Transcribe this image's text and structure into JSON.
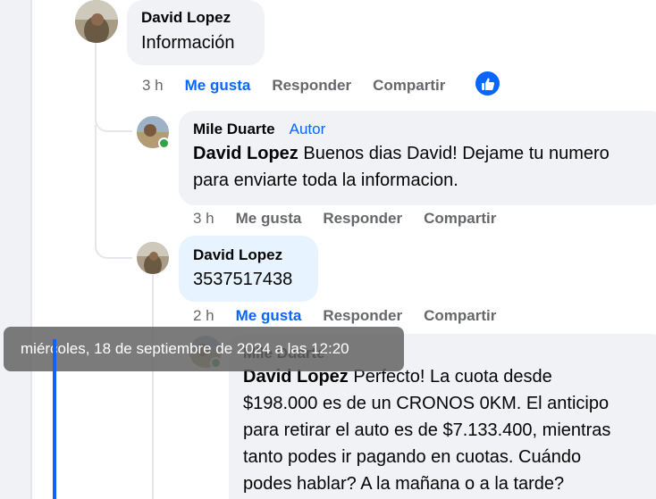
{
  "comments": [
    {
      "author": "David Lopez",
      "text": "Información",
      "time": "3 h",
      "like_label": "Me gusta",
      "reply_label": "Responder",
      "share_label": "Compartir"
    },
    {
      "author": "Mile Duarte",
      "badge": "Autor",
      "mention": "David Lopez",
      "text_line1": " Buenos dias David! Dejame tu numero",
      "text_line2": "para enviarte toda la informacion.",
      "time": "3 h",
      "like_label": "Me gusta",
      "reply_label": "Responder",
      "share_label": "Compartir"
    },
    {
      "author": "David Lopez",
      "text": "3537517438",
      "time": "2 h",
      "like_label": "Me gusta",
      "reply_label": "Responder",
      "share_label": "Compartir"
    },
    {
      "author": "Mile Duarte",
      "mention": "David Lopez",
      "text_line1": " Perfecto! La cuota desde",
      "text_line2": "$198.000 es de un CRONOS 0KM. El anticipo",
      "text_line3": "para retirar el auto es de $7.133.400, mientras",
      "text_line4": "tanto podes ir pagando en cuotas. Cuándo",
      "text_line5": "podes hablar? A la mañana o a la tarde?"
    }
  ],
  "tooltip": "miércoles, 18 de septiembre de 2024 a las 12:20",
  "colors": {
    "accent": "#0866ff",
    "bubble": "#f0f2f5",
    "bubble_highlight": "#e7f3ff",
    "muted": "#65676b",
    "online": "#31a24c"
  },
  "icons": [
    "like-thumb-icon",
    "online-status-icon"
  ]
}
